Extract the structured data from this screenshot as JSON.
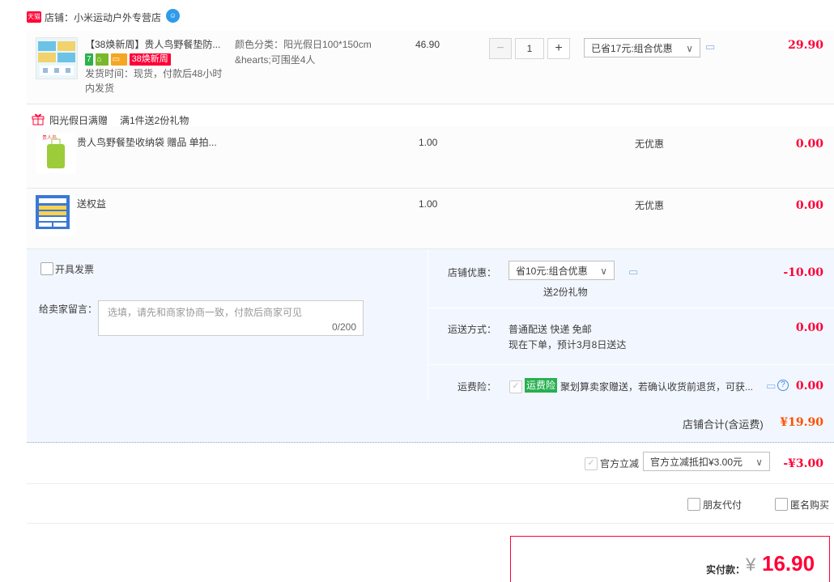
{
  "shop": {
    "badge": "天猫",
    "label": "店铺：",
    "name": "小米运动户外专营店"
  },
  "item1": {
    "title": "【38焕新周】贵人鸟野餐垫防...",
    "sku_line1": "颜色分类：阳光假日100*150cm",
    "sku_line2": "&hearts;可围坐4人",
    "tag_seven": "7",
    "tag_sale": "38焕新周",
    "shipping_line1": "发货时间：现货，付款后48小时",
    "shipping_line2": "内发货",
    "price": "46.90",
    "quantity": "1",
    "discount_select": "已省17元:组合优惠",
    "amount": "29.90"
  },
  "gift_header": {
    "label": "阳光假日满赠",
    "desc": "满1件送2份礼物"
  },
  "gift1": {
    "title": "贵人鸟野餐垫收纳袋 赠品 单拍...",
    "price": "1.00",
    "promo": "无优惠",
    "amount": "0.00"
  },
  "gift2": {
    "title": "送权益",
    "price": "1.00",
    "promo": "无优惠",
    "amount": "0.00"
  },
  "order": {
    "invoice_label": "开具发票",
    "message_label": "给卖家留言：",
    "message_placeholder": "选填，请先和商家协商一致，付款后商家可见",
    "message_counter": "0/200",
    "shop_discount_label": "店铺优惠：",
    "shop_discount_select": "省10元:组合优惠",
    "shop_discount_gift": "送2份礼物",
    "shop_discount_amount": "-10.00",
    "shipping_label": "运送方式：",
    "shipping_method": "普通配送 快递 免邮",
    "shipping_eta": "现在下单，预计3月8日送达",
    "shipping_amount": "0.00",
    "insurance_label": "运费险：",
    "insurance_tag": "运费险",
    "insurance_desc": "聚划算卖家赠送，若确认收货前退货，可获...",
    "insurance_amount": "0.00",
    "shop_total_label": "店铺合计(含运费)",
    "shop_total_amount": "¥19.90"
  },
  "official": {
    "label": "官方立减",
    "select": "官方立减抵扣¥3.00元",
    "amount": "-¥3.00"
  },
  "options": {
    "friend_pay": "朋友代付",
    "anonymous": "匿名购买"
  },
  "payment": {
    "label": "实付款：",
    "currency": "¥",
    "amount": "16.90"
  },
  "colors": {
    "accent_red": "#ff0036",
    "light_blue_bg": "#f2f7ff",
    "insurance_green": "#27b050"
  }
}
